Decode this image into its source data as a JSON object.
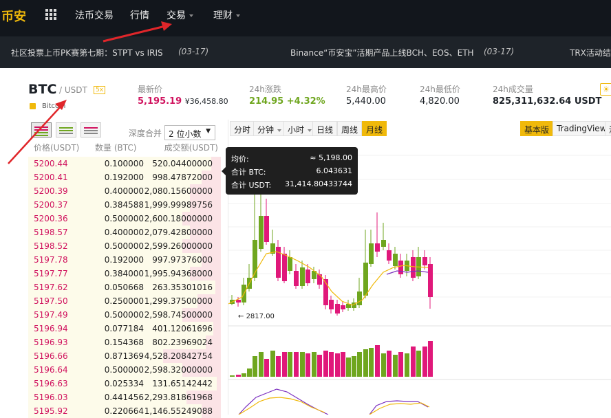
{
  "nav": {
    "logo": "币安",
    "items": [
      {
        "label": "法币交易"
      },
      {
        "label": "行情"
      },
      {
        "label": "交易"
      },
      {
        "label": "理财"
      }
    ]
  },
  "ticker": {
    "items": [
      {
        "text": "社区投票上币PK赛第七期：STPT vs IRIS",
        "date": "(03-17)"
      },
      {
        "text": "Binance“币安宝”活期产品上线BCH、EOS、ETH",
        "date": "(03-17)"
      },
      {
        "text": "TRX活动结",
        "date": ""
      }
    ]
  },
  "header": {
    "base": "BTC",
    "quote": "/ USDT",
    "leverage": "5x",
    "coin_name": "Bitcoin",
    "stats": [
      {
        "label": "最新价",
        "value": "5,195.19",
        "sub": "¥36,458.80"
      },
      {
        "label": "24h涨跌",
        "value": "214.95 +4.32%"
      },
      {
        "label": "24h最高价",
        "value": "5,440.00"
      },
      {
        "label": "24h最低价",
        "value": "4,820.00"
      },
      {
        "label": "24h成交量",
        "value": "825,311,632.64 USDT"
      }
    ]
  },
  "orderbook": {
    "depth_label": "深度合并",
    "depth_value": "2 位小数",
    "headers": {
      "price": "价格(USDT)",
      "qty": "数量 (BTC)",
      "total": "成交额(USDT)"
    },
    "rows": [
      {
        "price": "5200.44",
        "qty": "0.100000",
        "total": "520.04400000",
        "depth": 0.05
      },
      {
        "price": "5200.41",
        "qty": "0.192000",
        "total": "998.47872000",
        "depth": 0.1
      },
      {
        "price": "5200.39",
        "qty": "0.400000",
        "total": "2,080.15600000",
        "depth": 0.16
      },
      {
        "price": "5200.37",
        "qty": "0.384588",
        "total": "1,999.99989756",
        "depth": 0.16
      },
      {
        "price": "5200.36",
        "qty": "0.500000",
        "total": "2,600.18000000",
        "depth": 0.2
      },
      {
        "price": "5198.57",
        "qty": "0.400000",
        "total": "2,079.42800000",
        "depth": 0.16
      },
      {
        "price": "5198.52",
        "qty": "0.500000",
        "total": "2,599.26000000",
        "depth": 0.2
      },
      {
        "price": "5197.78",
        "qty": "0.192000",
        "total": "997.97376000",
        "depth": 0.1
      },
      {
        "price": "5197.77",
        "qty": "0.384000",
        "total": "1,995.94368000",
        "depth": 0.16
      },
      {
        "price": "5197.62",
        "qty": "0.050668",
        "total": "263.35301016",
        "depth": 0.03
      },
      {
        "price": "5197.50",
        "qty": "0.250000",
        "total": "1,299.37500000",
        "depth": 0.12
      },
      {
        "price": "5197.49",
        "qty": "0.500000",
        "total": "2,598.74500000",
        "depth": 0.2
      },
      {
        "price": "5196.94",
        "qty": "0.077184",
        "total": "401.12061696",
        "depth": 0.04
      },
      {
        "price": "5196.93",
        "qty": "0.154368",
        "total": "802.23969024",
        "depth": 0.08
      },
      {
        "price": "5196.66",
        "qty": "0.871369",
        "total": "4,528.20842754",
        "depth": 0.3
      },
      {
        "price": "5196.64",
        "qty": "0.500000",
        "total": "2,598.32000000",
        "depth": 0.2
      },
      {
        "price": "5196.63",
        "qty": "0.025334",
        "total": "131.65142442",
        "depth": 0.02
      },
      {
        "price": "5196.03",
        "qty": "0.441456",
        "total": "2,293.81861968",
        "depth": 0.18
      },
      {
        "price": "5195.92",
        "qty": "0.220664",
        "total": "1,146.55249088",
        "depth": 0.1
      }
    ]
  },
  "chart": {
    "timeframes": [
      {
        "label": "分时",
        "caret": false
      },
      {
        "label": "分钟",
        "caret": true
      },
      {
        "label": "小时",
        "caret": true
      },
      {
        "label": "日线",
        "caret": false
      },
      {
        "label": "周线",
        "caret": false
      },
      {
        "label": "月线",
        "caret": false,
        "active": true
      }
    ],
    "views": [
      {
        "label": "基本版",
        "active": true
      },
      {
        "label": "TradingView"
      },
      {
        "label": "深"
      }
    ],
    "tooltip": {
      "rows": [
        {
          "label": "均价:",
          "value": "≈ 5,198.00"
        },
        {
          "label": "合计 BTC:",
          "value": "6.043631"
        },
        {
          "label": "合计 USDT:",
          "value": "31,414.80433744"
        }
      ]
    },
    "low_label": "2817.00",
    "colors": {
      "up": "#6fa61f",
      "down": "#e0187a",
      "ma1": "#f0b90b",
      "ma2": "#7b2fbf"
    }
  }
}
